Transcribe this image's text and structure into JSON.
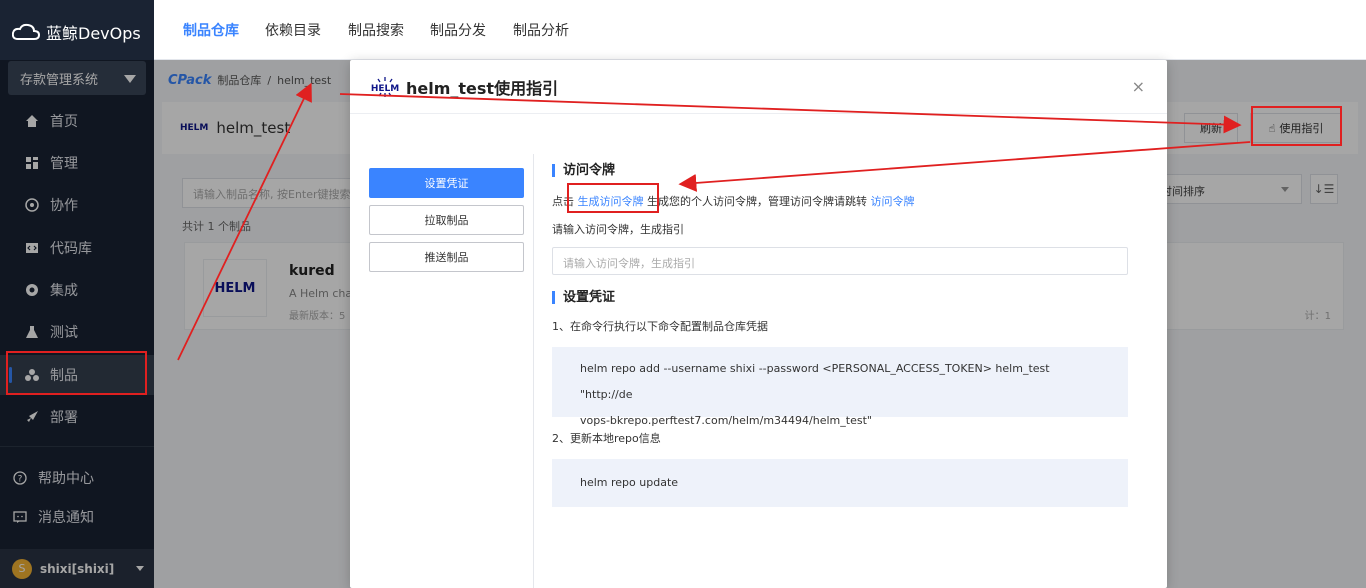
{
  "app": {
    "name": "蓝鲸DevOps",
    "system": "存款管理系统"
  },
  "sidebar": {
    "items": [
      {
        "label": "首页",
        "icon": "home-icon"
      },
      {
        "label": "管理",
        "icon": "manage-icon"
      },
      {
        "label": "协作",
        "icon": "collab-icon"
      },
      {
        "label": "代码库",
        "icon": "code-icon"
      },
      {
        "label": "集成",
        "icon": "ci-icon"
      },
      {
        "label": "测试",
        "icon": "test-icon"
      },
      {
        "label": "制品",
        "icon": "artifact-icon"
      },
      {
        "label": "部署",
        "icon": "deploy-icon"
      }
    ],
    "help": "帮助中心",
    "notify": "消息通知",
    "user": "shixi[shixi]",
    "avatar_letter": "S"
  },
  "topnav": {
    "tabs": [
      "制品仓库",
      "依赖目录",
      "制品搜索",
      "制品分发",
      "制品分析"
    ]
  },
  "breadcrumb": {
    "brand": "CPack",
    "root": "制品仓库",
    "sep": "/",
    "current": "helm_test"
  },
  "repo": {
    "name": "helm_test",
    "refresh": "刷新",
    "guide": "使用指引"
  },
  "list": {
    "search_placeholder": "请输入制品名称, 按Enter键搜索",
    "total": "共计 1 个制品",
    "sort": "时间排序",
    "item": {
      "name": "kured",
      "desc": "A Helm cha",
      "version": "最新版本：5",
      "downloads": "计：1"
    }
  },
  "modal": {
    "title": "helm_test使用指引",
    "close": "×",
    "tabs": [
      "设置凭证",
      "拉取制品",
      "推送制品"
    ],
    "token": {
      "heading": "访问令牌",
      "line_prefix": "点击 ",
      "link1": "生成访问令牌",
      "line_mid": " 生成您的个人访问令牌，管理访问令牌请跳转 ",
      "link2": "访问令牌",
      "hint": "请输入访问令牌，生成指引",
      "placeholder": "请输入访问令牌，生成指引"
    },
    "cred": {
      "heading": "设置凭证",
      "step1": "1、在命令行执行以下命令配置制品仓库凭据",
      "cmd1_line1": "helm repo add --username shixi --password <PERSONAL_ACCESS_TOKEN> helm_test \"http://de",
      "cmd1_line2": "vops-bkrepo.perftest7.com/helm/m34494/helm_test\"",
      "step2": "2、更新本地repo信息",
      "cmd2": "helm repo update"
    }
  },
  "colors": {
    "accent": "#3a84ff",
    "sidebar": "#1a2333",
    "annotation": "#e02020"
  }
}
